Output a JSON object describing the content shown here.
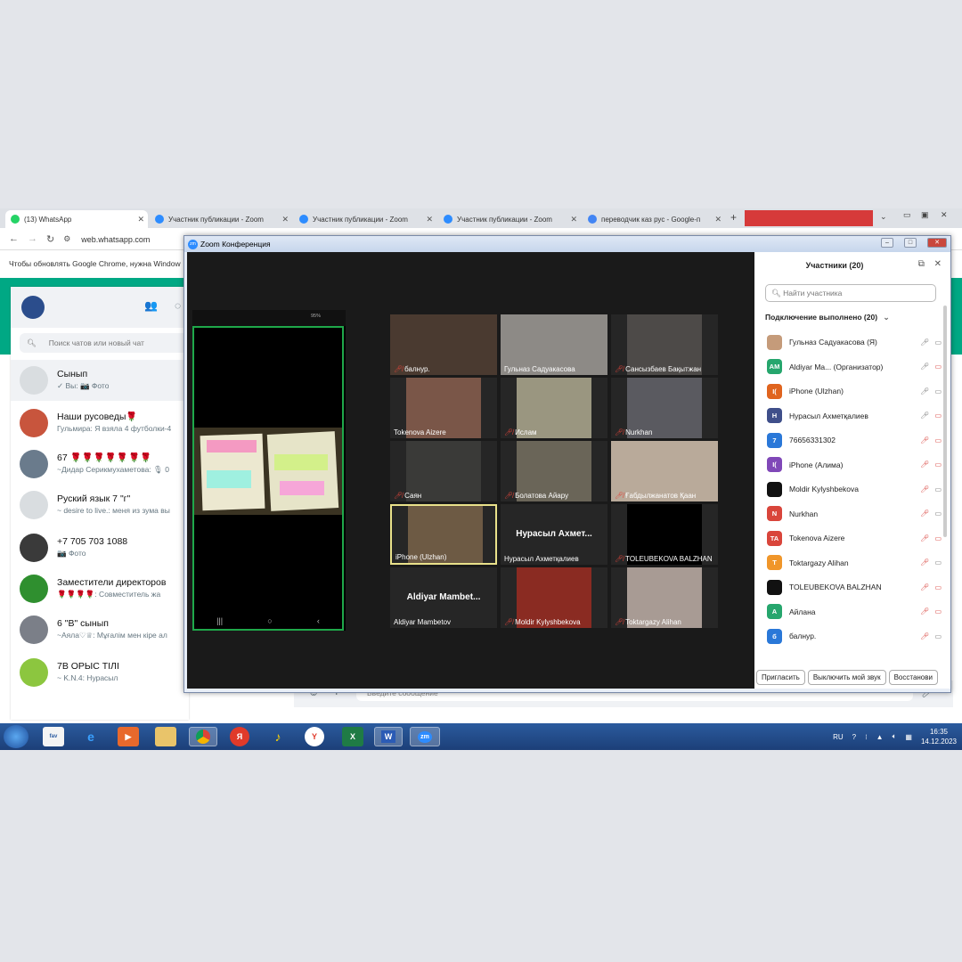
{
  "browser": {
    "tabs": [
      {
        "label": "(13) WhatsApp",
        "badge": "13"
      },
      {
        "label": "Участник публикации - Zoom"
      },
      {
        "label": "Участник публикации - Zoom"
      },
      {
        "label": "Участник публикации - Zoom"
      },
      {
        "label": "переводчик каз рус - Google-п"
      }
    ],
    "url": "web.whatsapp.com",
    "infobar": "Чтобы обновлять Google Chrome, нужна Window"
  },
  "whatsapp": {
    "search_placeholder": "Поиск чатов или новый чат",
    "message_placeholder": "Введите сообщение",
    "chats": [
      {
        "name": "Сынып",
        "msg": "✓ Вы: 📷 Фото",
        "avatar": "#d9dde0"
      },
      {
        "name": "Наши русоведы🌹",
        "msg": "Гульмира: Я взяла 4 футболки-4",
        "avatar": "#c8553d"
      },
      {
        "name": "67 🌹🌹🌹🌹🌹🌹🌹",
        "msg": "~Дидар  Серикмухаметова: 🎙 0",
        "avatar": "#6a7b8c"
      },
      {
        "name": "Руский язык 7 \"г\"",
        "msg": "~ desire to live.: меня из зума вы",
        "avatar": "#d9dde0"
      },
      {
        "name": "+7 705 703 1088",
        "msg": "📷 Фото",
        "avatar": "#3a3a3a"
      },
      {
        "name": "Заместители директоров",
        "msg": "🌹🌹🌹🌹: Совместитель жа",
        "avatar": "#2f8f2f"
      },
      {
        "name": "6 \"В\" сынып",
        "msg": "~Аяла♡♕: Мұғалім мен кіре ал",
        "avatar": "#7b7f88"
      },
      {
        "name": "7В ОРЫС ТІЛІ",
        "msg": "~ K.N.4: Нурасыл",
        "avatar": "#8cc63f"
      }
    ]
  },
  "zoom": {
    "title": "Zoom Конференция",
    "phone_battery": "95%",
    "tiles": [
      {
        "label": "балнур.",
        "muted": true,
        "bg": "#4a3a30"
      },
      {
        "label": "Гульназ Садуакасова",
        "muted": false,
        "bg": "#8d8a86"
      },
      {
        "label": "Сансызбаев Бақытжан",
        "muted": true,
        "bg": "#4d4a48"
      },
      {
        "label": "Tokenova Aizere",
        "muted": false,
        "bg": "#7a5648"
      },
      {
        "label": "Ислам",
        "muted": true,
        "bg": "#9a9680"
      },
      {
        "label": "Nurkhan",
        "muted": true,
        "bg": "#5a5a60"
      },
      {
        "label": "Саян",
        "muted": true,
        "bg": "#3a3a38"
      },
      {
        "label": "Болатова Айару",
        "muted": true,
        "bg": "#6a6558"
      },
      {
        "label": "Ғабдылжанатов Қаан",
        "muted": true,
        "bg": "#b9aa9a"
      },
      {
        "label": "iPhone (Ulzhan)",
        "muted": false,
        "bg": "#6d5a44"
      },
      {
        "label": "Нурасыл Ахметқалиев",
        "muted": false,
        "big": "Нурасыл  Ахмет..."
      },
      {
        "label": "TOLEUBEKOVA BALZHAN",
        "muted": true,
        "bg": "#000000"
      },
      {
        "label": "Aldiyar Mambetov",
        "muted": false,
        "big": "Aldiyar  Mambet..."
      },
      {
        "label": "Moldir Kylyshbekova",
        "muted": true,
        "bg": "#8a2b22"
      },
      {
        "label": "Toktargazy Alihan",
        "muted": true,
        "bg": "#a89b94"
      }
    ],
    "participants": {
      "title": "Участники (20)",
      "search_placeholder": "Найти участника",
      "connected": "Подключение выполнено (20)",
      "list": [
        {
          "initials": "",
          "name": "Гульназ Садуакасова (Я)",
          "color": "#c59b7a",
          "mic": "on",
          "cam": "on"
        },
        {
          "initials": "AM",
          "name": "Aldiyar Ma... (Организатор)",
          "color": "#26a66d",
          "mic": "on",
          "cam": "off"
        },
        {
          "initials": "I(",
          "name": "iPhone (Ulzhan)",
          "color": "#e0641e",
          "mic": "on",
          "cam": "on"
        },
        {
          "initials": "H",
          "name": "Нурасыл Ахметқалиев",
          "color": "#3f4f8a",
          "mic": "on",
          "cam": "off"
        },
        {
          "initials": "7",
          "name": "76656331302",
          "color": "#2a78d8",
          "mic": "off",
          "cam": "off"
        },
        {
          "initials": "I(",
          "name": "iPhone (Алима)",
          "color": "#8048b8",
          "mic": "off",
          "cam": "off"
        },
        {
          "initials": "",
          "name": "Moldir Kylyshbekova",
          "color": "#111111",
          "mic": "off",
          "cam": "on"
        },
        {
          "initials": "N",
          "name": "Nurkhan",
          "color": "#d9453b",
          "mic": "off",
          "cam": "on"
        },
        {
          "initials": "TA",
          "name": "Tokenova Aizere",
          "color": "#d9453b",
          "mic": "off",
          "cam": "off"
        },
        {
          "initials": "T",
          "name": "Toktargazy Alihan",
          "color": "#f0962a",
          "mic": "off",
          "cam": "on"
        },
        {
          "initials": "",
          "name": "TOLEUBEKOVA BALZHAN",
          "color": "#111111",
          "mic": "off",
          "cam": "off"
        },
        {
          "initials": "A",
          "name": "Айлана",
          "color": "#26a66d",
          "mic": "off",
          "cam": "off"
        },
        {
          "initials": "б",
          "name": "балнур.",
          "color": "#2a78d8",
          "mic": "off",
          "cam": "on"
        }
      ],
      "buttons": [
        "Пригласить",
        "Выключить мой звук",
        "Восстанови"
      ]
    }
  },
  "taskbar": {
    "lang": "RU",
    "time": "16:35",
    "date": "14.12.2023"
  }
}
